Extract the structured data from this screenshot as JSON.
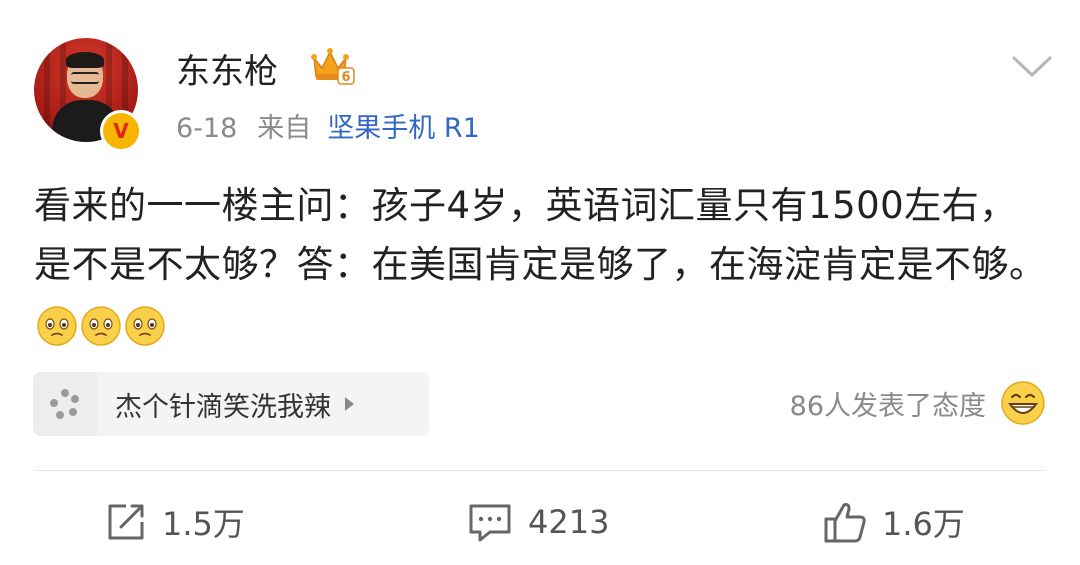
{
  "post": {
    "username": "东东枪",
    "level_badge": "6",
    "verified_mark": "V",
    "date": "6-18",
    "from_label": "来自",
    "source": "坚果手机 R1",
    "text": "看来的一一楼主问：孩子4岁，英语词汇量只有1500左右，是不是不太够？答：在美国肯定是够了，在海淀肯定是不够。",
    "emoji_names": [
      "teary-eyes-emoji",
      "teary-eyes-emoji",
      "teary-eyes-emoji"
    ]
  },
  "topic": {
    "label": "杰个针滴笑洗我辣"
  },
  "reactions": {
    "text": "86人发表了态度"
  },
  "actions": {
    "repost_count": "1.5万",
    "comment_count": "4213",
    "like_count": "1.6万"
  },
  "icons": {
    "crown": "crown-level-icon",
    "more": "chevron-down-icon",
    "topic": "pinwheel-icon",
    "repost": "repost-icon",
    "comment": "comment-icon",
    "like": "thumbs-up-icon",
    "reaction": "grin-emoji-icon"
  },
  "colors": {
    "link_blue": "#3367c5",
    "meta_gray": "#8a8a8a",
    "badge_gold": "#f7b500",
    "badge_red": "#e3261b"
  }
}
